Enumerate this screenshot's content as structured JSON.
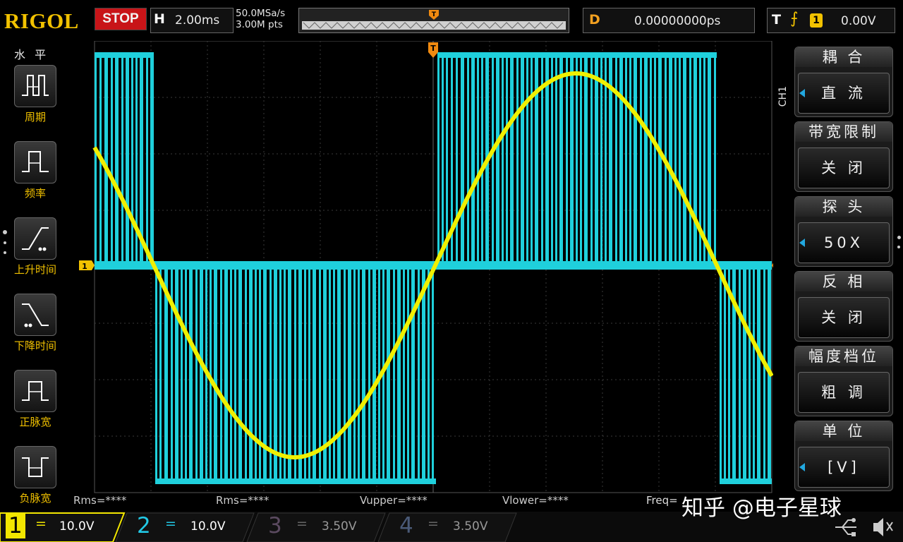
{
  "header": {
    "brand": "RIGOL",
    "run_status": "STOP",
    "timebase_label": "H",
    "timebase_value": "2.00ms",
    "sample_rate": "50.0MSa/s",
    "memory_depth": "3.00M pts",
    "delay_label": "D",
    "delay_value": "0.00000000ps",
    "trigger_label": "T",
    "trigger_source": "1",
    "trigger_level": "0.00V"
  },
  "left_menu": {
    "title": "水 平",
    "items": [
      {
        "label": "周期",
        "icon": "period-icon"
      },
      {
        "label": "频率",
        "icon": "frequency-icon"
      },
      {
        "label": "上升时间",
        "icon": "rise-time-icon"
      },
      {
        "label": "下降时间",
        "icon": "fall-time-icon"
      },
      {
        "label": "正脉宽",
        "icon": "positive-width-icon"
      },
      {
        "label": "负脉宽",
        "icon": "negative-width-icon"
      }
    ]
  },
  "right_menu": {
    "channel": "CH1",
    "groups": [
      {
        "title": "耦 合",
        "value": "直 流"
      },
      {
        "title": "带宽限制",
        "value": "关 闭"
      },
      {
        "title": "探 头",
        "value": "50X"
      },
      {
        "title": "反 相",
        "value": "关 闭"
      },
      {
        "title": "幅度档位",
        "value": "粗 调"
      },
      {
        "title": "单 位",
        "value": "[V]"
      }
    ]
  },
  "measurements": [
    "Rms=****",
    "Rms=****",
    "Vupper=****",
    "Vlower=****",
    "Freq="
  ],
  "channels": [
    {
      "num": "1",
      "eq": "=",
      "value": "10.0V",
      "color": "#f2e600"
    },
    {
      "num": "2",
      "eq": "=",
      "value": "10.0V",
      "color": "#22c9e6"
    },
    {
      "num": "3",
      "eq": "=",
      "value": "3.50V",
      "color": "#b0208a"
    },
    {
      "num": "4",
      "eq": "=",
      "value": "3.50V",
      "color": "#2f7ad8"
    }
  ],
  "markers": {
    "ch1": "1",
    "trigger": "T"
  },
  "watermark": "知乎 @电子星球",
  "colors": {
    "ch1": "#f0f000",
    "ch2": "#1fd0dc",
    "accent": "#f2c200",
    "stop": "#c81418"
  }
}
